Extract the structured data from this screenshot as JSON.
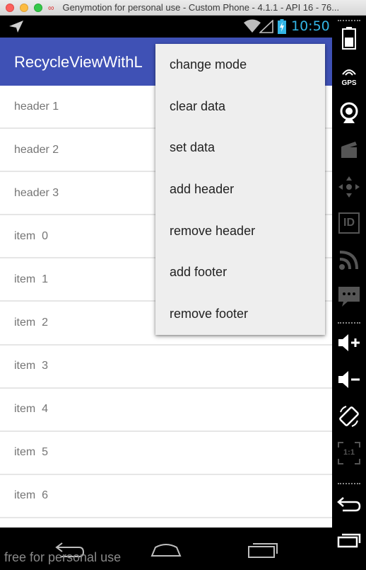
{
  "window": {
    "title": "Genymotion for personal use - Custom Phone - 4.1.1 - API 16 - 76..."
  },
  "statusbar": {
    "time": "10:50",
    "time_color": "#33b5e5"
  },
  "appbar": {
    "title": "RecycleViewWithL",
    "color": "#3f51b5"
  },
  "list": {
    "items": [
      {
        "label": "header 1"
      },
      {
        "label": "header 2"
      },
      {
        "label": "header 3"
      },
      {
        "label": "item  0"
      },
      {
        "label": "item  1"
      },
      {
        "label": "item  2"
      },
      {
        "label": "item  3"
      },
      {
        "label": "item  4"
      },
      {
        "label": "item  5"
      },
      {
        "label": "item  6"
      }
    ]
  },
  "menu": {
    "items": [
      {
        "label": "change mode"
      },
      {
        "label": "clear data"
      },
      {
        "label": "set data"
      },
      {
        "label": "add header"
      },
      {
        "label": "remove header"
      },
      {
        "label": "add footer"
      },
      {
        "label": "remove footer"
      }
    ]
  },
  "sidebar": {
    "gps_label": "GPS",
    "id_label": "ID",
    "pixel_perfect_label": "1:1"
  },
  "watermark": "free for personal use"
}
